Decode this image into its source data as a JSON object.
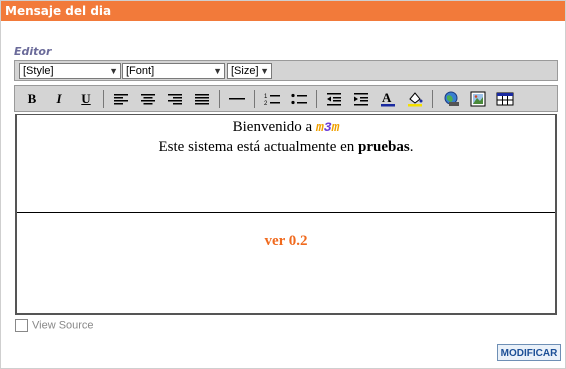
{
  "panel": {
    "title": "Mensaje del dia",
    "editor_label": "Editor"
  },
  "toolbar": {
    "style_select": "[Style]",
    "font_select": "[Font]",
    "size_select": "[Size]",
    "bold": "B",
    "italic": "I",
    "underline": "U"
  },
  "content": {
    "welcome_prefix": "Bienvenido a ",
    "brand_m1": "m",
    "brand_3": "3",
    "brand_m2": "m",
    "line2_prefix": "Este sistema está actualmente en ",
    "line2_bold": "pruebas",
    "line2_suffix": ".",
    "version": "ver 0.2"
  },
  "footer": {
    "view_source_label": "View Source",
    "submit_label": "MODIFICAR"
  },
  "colors": {
    "title_bar": "#f27a3a",
    "version_text": "#f06a1e",
    "brand_m": "#f0a000",
    "brand_3": "#6b3cd8"
  }
}
